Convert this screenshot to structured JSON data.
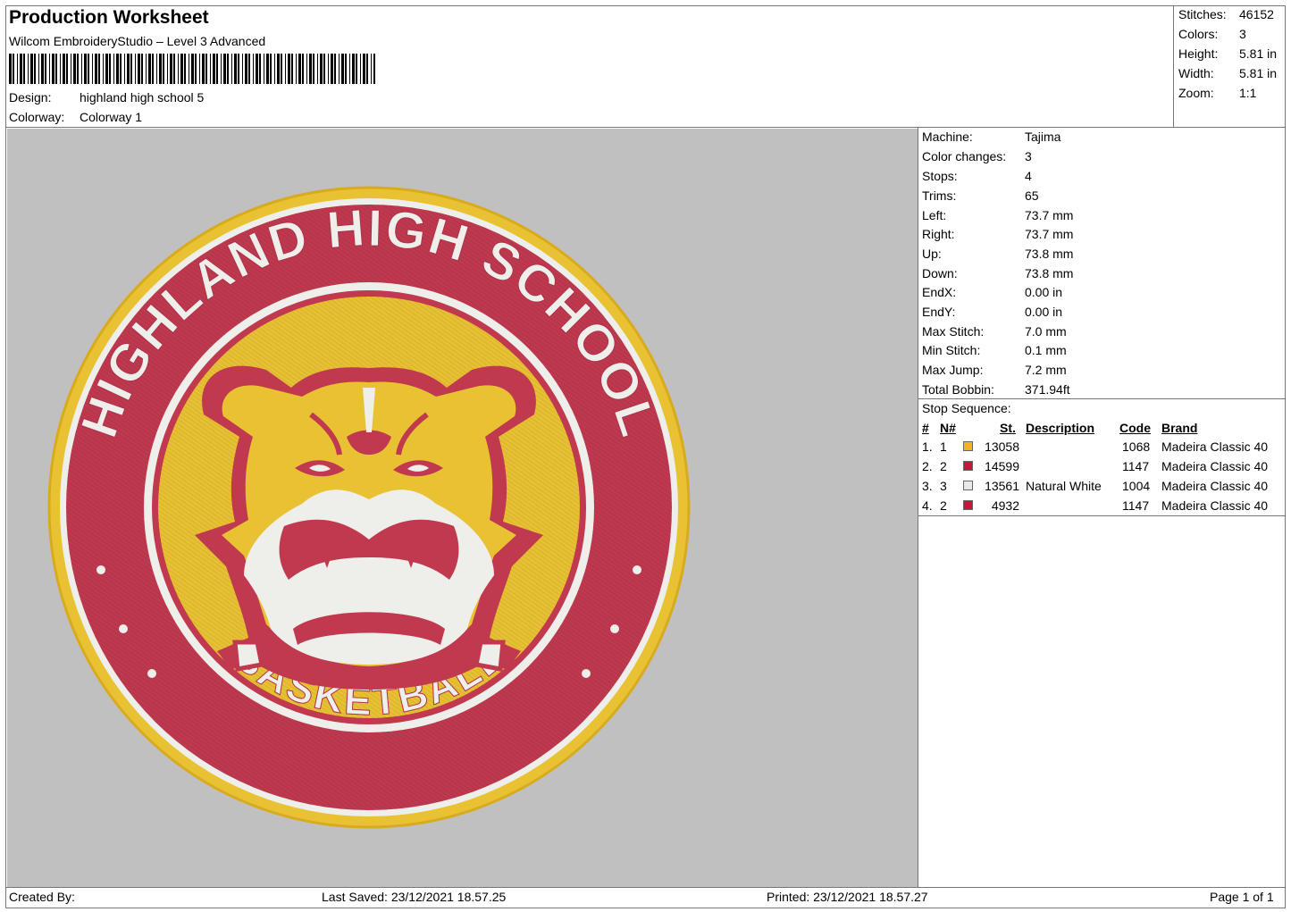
{
  "header": {
    "title": "Production Worksheet",
    "software": "Wilcom EmbroideryStudio – Level 3 Advanced",
    "design_label": "Design:",
    "design_value": "highland high school 5",
    "colorway_label": "Colorway:",
    "colorway_value": "Colorway 1"
  },
  "stats": [
    {
      "label": "Stitches:",
      "value": "46152"
    },
    {
      "label": "Colors:",
      "value": "3"
    },
    {
      "label": "Height:",
      "value": "5.81 in"
    },
    {
      "label": "Width:",
      "value": "5.81 in"
    },
    {
      "label": "Zoom:",
      "value": "1:1"
    }
  ],
  "machine_info": [
    {
      "label": "Machine:",
      "value": "Tajima"
    },
    {
      "label": "Color changes:",
      "value": "3"
    },
    {
      "label": "Stops:",
      "value": "4"
    },
    {
      "label": "Trims:",
      "value": "65"
    },
    {
      "label": "Left:",
      "value": "73.7 mm"
    },
    {
      "label": "Right:",
      "value": "73.7 mm"
    },
    {
      "label": "Up:",
      "value": "73.8 mm"
    },
    {
      "label": "Down:",
      "value": "73.8 mm"
    },
    {
      "label": "EndX:",
      "value": "0.00 in"
    },
    {
      "label": "EndY:",
      "value": "0.00 in"
    },
    {
      "label": "Max Stitch:",
      "value": "7.0 mm"
    },
    {
      "label": "Min Stitch:",
      "value": "0.1 mm"
    },
    {
      "label": "Max Jump:",
      "value": "7.2 mm"
    },
    {
      "label": "Total Bobbin:",
      "value": "371.94ft"
    }
  ],
  "stop_sequence": {
    "title": "Stop Sequence:",
    "headers": {
      "num": "#",
      "n": "N#",
      "st": "St.",
      "desc": "Description",
      "code": "Code",
      "brand": "Brand"
    },
    "rows": [
      {
        "num": "1.",
        "n": "1",
        "color": "#f2b31c",
        "st": "13058",
        "desc": "",
        "code": "1068",
        "brand": "Madeira Classic 40"
      },
      {
        "num": "2.",
        "n": "2",
        "color": "#c4183a",
        "st": "14599",
        "desc": "",
        "code": "1147",
        "brand": "Madeira Classic 40"
      },
      {
        "num": "3.",
        "n": "3",
        "color": "#e8e8ec",
        "st": "13561",
        "desc": "Natural White",
        "code": "1004",
        "brand": "Madeira Classic 40"
      },
      {
        "num": "4.",
        "n": "2",
        "color": "#c4183a",
        "st": "4932",
        "desc": "",
        "code": "1147",
        "brand": "Madeira Classic 40"
      }
    ]
  },
  "design_art": {
    "top_text": "HIGHLAND HIGH SCHOOL",
    "bottom_text": "BASKETBALL",
    "colors": {
      "gold": "#e9c233",
      "gold_dark": "#d8ab1f",
      "red": "#c0394f",
      "white": "#eeeeea",
      "background": "#c0c0c0"
    }
  },
  "footer": {
    "created_by": "Created By:",
    "last_saved": "Last Saved: 23/12/2021 18.57.25",
    "printed": "Printed: 23/12/2021 18.57.27",
    "page": "Page 1 of 1"
  }
}
